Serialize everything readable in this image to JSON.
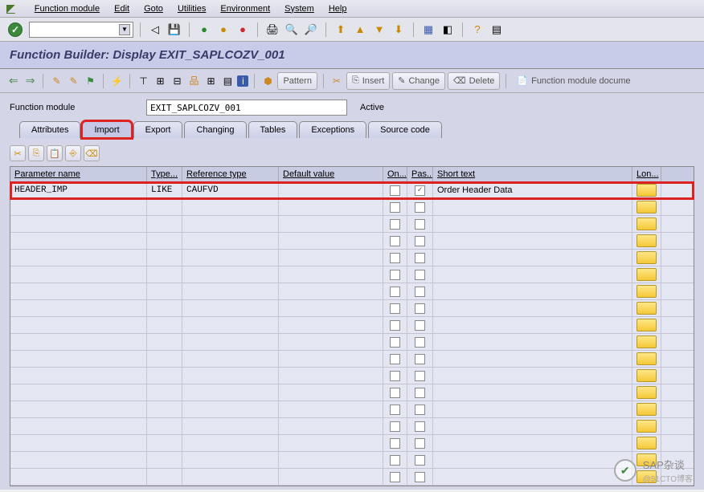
{
  "menu": {
    "items": [
      "Function module",
      "Edit",
      "Goto",
      "Utilities",
      "Environment",
      "System",
      "Help"
    ]
  },
  "title": "Function Builder: Display EXIT_SAPLCOZV_001",
  "toolbar2": {
    "pattern": "Pattern",
    "insert": "Insert",
    "change": "Change",
    "delete": "Delete",
    "docume": "Function module docume"
  },
  "form": {
    "label": "Function module",
    "value": "EXIT_SAPLCOZV_001",
    "status": "Active"
  },
  "tabs": [
    "Attributes",
    "Import",
    "Export",
    "Changing",
    "Tables",
    "Exceptions",
    "Source code"
  ],
  "grid": {
    "headers": {
      "param": "Parameter name",
      "type": "Type...",
      "ref": "Reference type",
      "def": "Default value",
      "on": "On...",
      "pas": "Pas...",
      "short": "Short text",
      "lon": "Lon..."
    },
    "rows": [
      {
        "param": "HEADER_IMP",
        "type": "LIKE",
        "ref": "CAUFVD",
        "def": "",
        "on": false,
        "pas": true,
        "short": "Order Header Data"
      }
    ],
    "emptyRows": 17
  },
  "watermark": {
    "main": "SAP杂谈",
    "sub": "@51CTO博客"
  }
}
